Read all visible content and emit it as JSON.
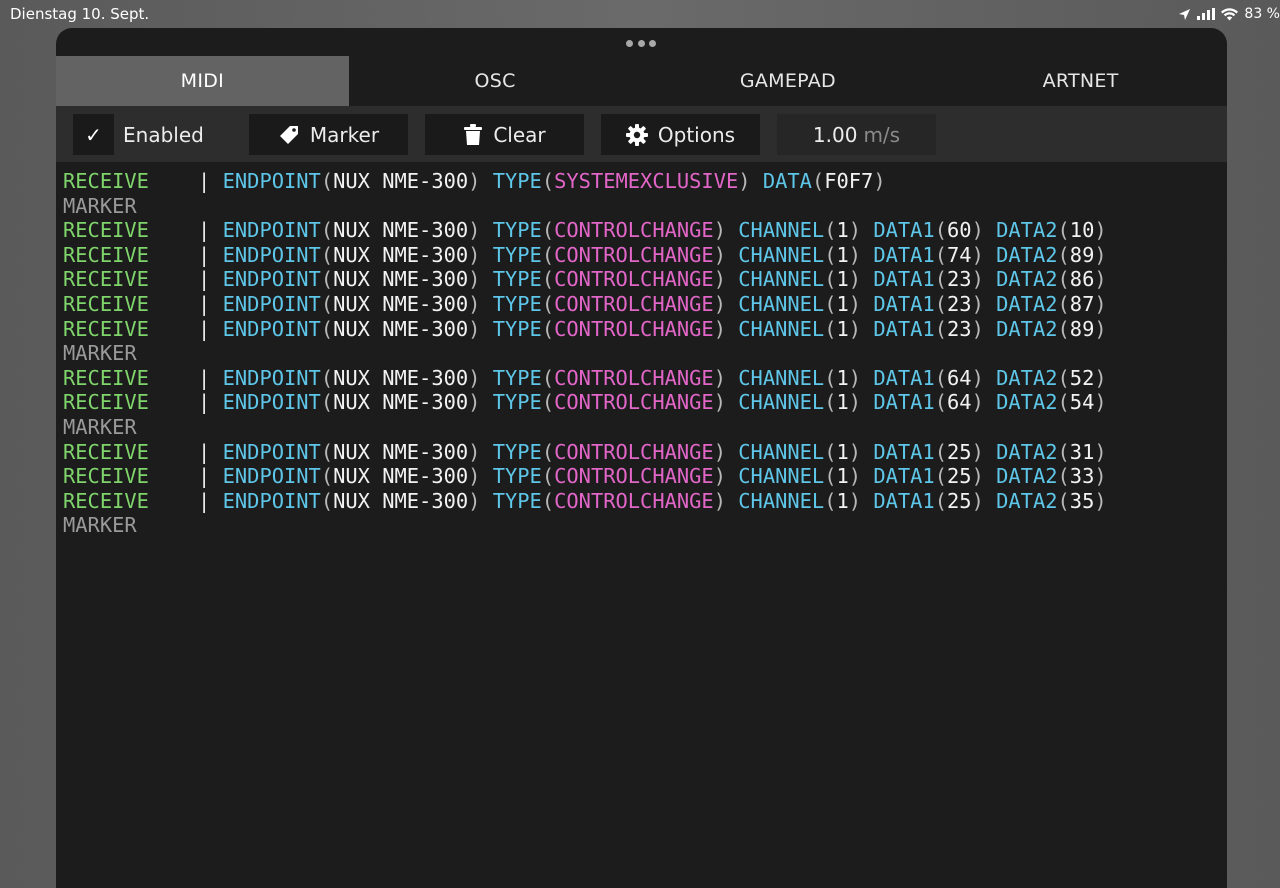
{
  "status": {
    "date": "Dienstag 10. Sept.",
    "battery": "83 %"
  },
  "tabs": [
    {
      "label": "MIDI",
      "active": true
    },
    {
      "label": "OSC",
      "active": false
    },
    {
      "label": "GAMEPAD",
      "active": false
    },
    {
      "label": "ARTNET",
      "active": false
    }
  ],
  "toolbar": {
    "enabled_check": "✓",
    "enabled_label": "Enabled",
    "marker_label": "Marker",
    "clear_label": "Clear",
    "options_label": "Options",
    "rate_value": "1.00",
    "rate_unit": "m/s"
  },
  "colors": {
    "receive": "#7fd46b",
    "marker": "#9a9a9a",
    "keyword": "#5ec6e8",
    "type_value": "#e266c8",
    "active_tab": "#636363"
  },
  "log": [
    {
      "kind": "receive",
      "label": "RECEIVE",
      "endpoint": "NUX NME-300",
      "type": "SYSTEMEXCLUSIVE",
      "data": "F0F7"
    },
    {
      "kind": "marker",
      "label": "MARKER"
    },
    {
      "kind": "receive",
      "label": "RECEIVE",
      "endpoint": "NUX NME-300",
      "type": "CONTROLCHANGE",
      "channel": "1",
      "data1": "60",
      "data2": "10"
    },
    {
      "kind": "receive",
      "label": "RECEIVE",
      "endpoint": "NUX NME-300",
      "type": "CONTROLCHANGE",
      "channel": "1",
      "data1": "74",
      "data2": "89"
    },
    {
      "kind": "receive",
      "label": "RECEIVE",
      "endpoint": "NUX NME-300",
      "type": "CONTROLCHANGE",
      "channel": "1",
      "data1": "23",
      "data2": "86"
    },
    {
      "kind": "receive",
      "label": "RECEIVE",
      "endpoint": "NUX NME-300",
      "type": "CONTROLCHANGE",
      "channel": "1",
      "data1": "23",
      "data2": "87"
    },
    {
      "kind": "receive",
      "label": "RECEIVE",
      "endpoint": "NUX NME-300",
      "type": "CONTROLCHANGE",
      "channel": "1",
      "data1": "23",
      "data2": "89"
    },
    {
      "kind": "marker",
      "label": "MARKER"
    },
    {
      "kind": "receive",
      "label": "RECEIVE",
      "endpoint": "NUX NME-300",
      "type": "CONTROLCHANGE",
      "channel": "1",
      "data1": "64",
      "data2": "52"
    },
    {
      "kind": "receive",
      "label": "RECEIVE",
      "endpoint": "NUX NME-300",
      "type": "CONTROLCHANGE",
      "channel": "1",
      "data1": "64",
      "data2": "54"
    },
    {
      "kind": "marker",
      "label": "MARKER"
    },
    {
      "kind": "receive",
      "label": "RECEIVE",
      "endpoint": "NUX NME-300",
      "type": "CONTROLCHANGE",
      "channel": "1",
      "data1": "25",
      "data2": "31"
    },
    {
      "kind": "receive",
      "label": "RECEIVE",
      "endpoint": "NUX NME-300",
      "type": "CONTROLCHANGE",
      "channel": "1",
      "data1": "25",
      "data2": "33"
    },
    {
      "kind": "receive",
      "label": "RECEIVE",
      "endpoint": "NUX NME-300",
      "type": "CONTROLCHANGE",
      "channel": "1",
      "data1": "25",
      "data2": "35"
    },
    {
      "kind": "marker",
      "label": "MARKER"
    }
  ]
}
